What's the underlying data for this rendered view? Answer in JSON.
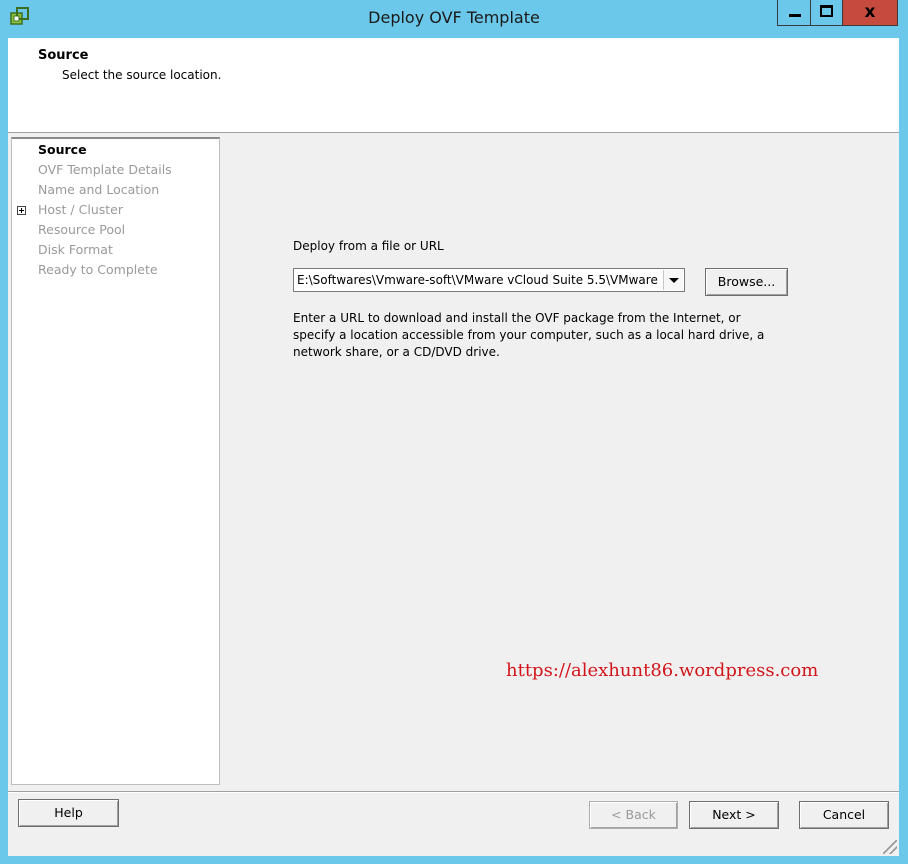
{
  "window": {
    "title": "Deploy OVF Template",
    "icon": "vsphere-client-icon",
    "controls": {
      "minimize": "minimize-icon",
      "maximize": "maximize-icon",
      "close": "x"
    }
  },
  "header": {
    "title": "Source",
    "subtitle": "Select the source location."
  },
  "nav": {
    "items": [
      {
        "label": "Source",
        "active": true
      },
      {
        "label": "OVF Template Details"
      },
      {
        "label": "Name and Location"
      },
      {
        "label": "Host / Cluster",
        "expandable": true
      },
      {
        "label": "Resource Pool"
      },
      {
        "label": "Disk Format"
      },
      {
        "label": "Ready to Complete"
      }
    ]
  },
  "content": {
    "label": "Deploy from a file or URL",
    "source_value": "E:\\Softwares\\Vmware-soft\\VMware vCloud Suite 5.5\\VMware",
    "browse_label": "Browse...",
    "description": "Enter a URL to download and install the OVF package from the Internet, or specify a location accessible from your computer, such as a local hard drive, a network share, or a CD/DVD drive."
  },
  "watermark": "https://alexhunt86.wordpress.com",
  "footer": {
    "help": "Help",
    "back": "< Back",
    "next": "Next >",
    "cancel": "Cancel"
  },
  "colors": {
    "titlebar": "#6cc8ea",
    "close_button": "#c74a3f",
    "watermark": "#d2151b"
  }
}
